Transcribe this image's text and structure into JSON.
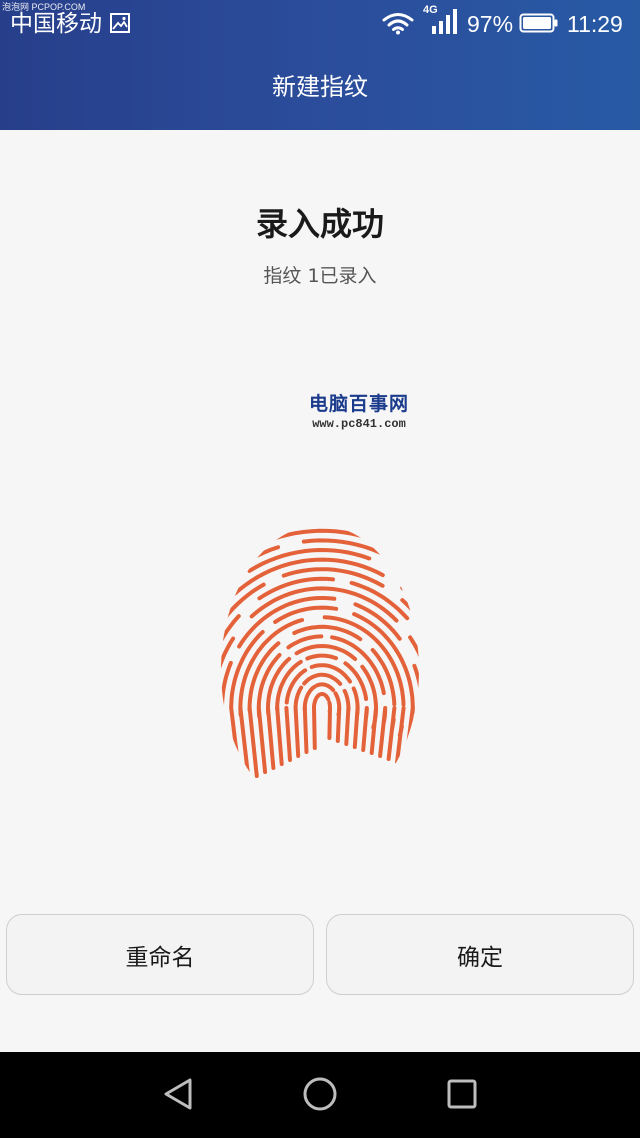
{
  "status_bar": {
    "watermark": "泡泡网 PCPOP.COM",
    "carrier": "中国移动",
    "network_type": "4G",
    "battery_percent": "97%",
    "time": "11:29"
  },
  "header": {
    "title": "新建指纹"
  },
  "main": {
    "heading": "录入成功",
    "subheading": "指纹 1已录入",
    "fingerprint_color": "#e4623a"
  },
  "watermark": {
    "site_name": "电脑百事网",
    "site_url": "www.pc841.com"
  },
  "buttons": {
    "rename_label": "重命名",
    "confirm_label": "确定"
  },
  "nav": {
    "items": [
      "back-icon",
      "home-icon",
      "recent-apps-icon"
    ]
  },
  "colors": {
    "header_gradient_start": "#273f8b",
    "header_gradient_end": "#285aa4",
    "page_background": "#f6f6f6",
    "nav_background": "#000000"
  }
}
